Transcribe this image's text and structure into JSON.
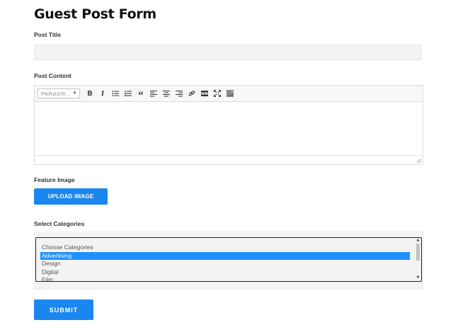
{
  "form": {
    "title": "Guest Post Form",
    "post_title_label": "Post Title",
    "post_title_value": "",
    "post_content_label": "Post Content",
    "feature_image_label": "Feature Image",
    "upload_button_label": "UPLOAD IMAGE",
    "categories_label": "Select Categories",
    "submit_label": "SUBMIT"
  },
  "editor": {
    "format_value": "PARAGR...",
    "toolbar": [
      {
        "name": "bold-icon",
        "glyph": "B"
      },
      {
        "name": "italic-icon",
        "glyph": "I"
      },
      {
        "name": "bullet-list-icon"
      },
      {
        "name": "numbered-list-icon"
      },
      {
        "name": "blockquote-icon",
        "glyph": "“"
      },
      {
        "name": "align-left-icon"
      },
      {
        "name": "align-center-icon"
      },
      {
        "name": "align-right-icon"
      },
      {
        "name": "link-icon"
      },
      {
        "name": "read-more-icon"
      },
      {
        "name": "fullscreen-icon"
      },
      {
        "name": "toolbar-toggle-icon"
      }
    ],
    "content": ""
  },
  "categories": {
    "options": [
      {
        "label": "Choose Categories",
        "selected": false
      },
      {
        "label": "Advertising",
        "selected": true
      },
      {
        "label": "Design",
        "selected": false
      },
      {
        "label": "Digital",
        "selected": false
      },
      {
        "label": "Film",
        "selected": false
      }
    ]
  },
  "colors": {
    "accent": "#1a87f0",
    "selected_option": "#1e90ff",
    "field_background": "#f3f3f3"
  }
}
